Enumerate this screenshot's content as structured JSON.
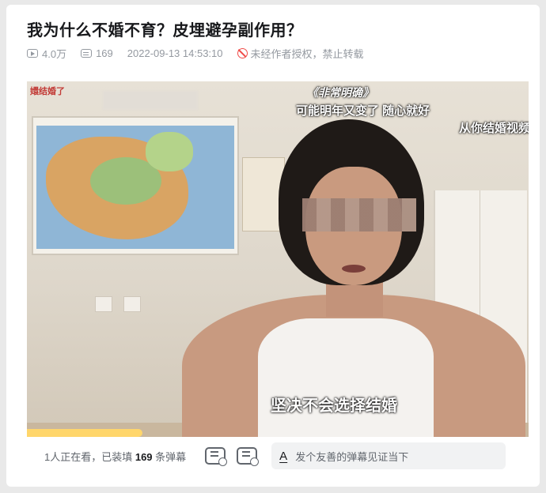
{
  "title": "我为什么不婚不育？皮埋避孕副作用？",
  "meta": {
    "views": "4.0万",
    "danmaku": "169",
    "datetime": "2022-09-13 14:53:10",
    "copyright": "未经作者授权，禁止转载"
  },
  "video": {
    "logo": "嬛结婚了",
    "captions": {
      "show": "《非常明确》",
      "line1": "可能明年又变了 随心就好",
      "line2": "从你结婚视频",
      "subtitle": "坚决不会选择结婚"
    },
    "progress": 0.23
  },
  "bar": {
    "viewer_prefix": "1人正在看，已装填 ",
    "viewer_count": "169",
    "viewer_suffix": " 条弹幕",
    "input_icon": "A",
    "input_placeholder": "发个友善的弹幕见证当下",
    "icons": [
      "danmaku-toggle-icon",
      "danmaku-settings-icon",
      "font-icon"
    ]
  }
}
